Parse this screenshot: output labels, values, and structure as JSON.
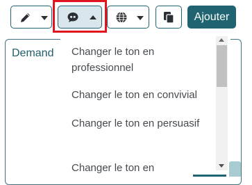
{
  "toolbar": {
    "edit_icon": "pencil-icon",
    "tone_icon": "speech-quote-icon",
    "language_icon": "globe-icon",
    "copy_icon": "copy-icon",
    "add_label": "Ajouter"
  },
  "panel": {
    "label": "Demand"
  },
  "menu": {
    "items": [
      "Changer le ton en professionnel",
      "Changer le ton en convivial",
      "Changer le ton en persuasif",
      "Changer le ton en"
    ]
  },
  "colors": {
    "accent": "#1f6470",
    "highlight": "#e0161f",
    "active_button_bg": "#d9e7ec"
  }
}
